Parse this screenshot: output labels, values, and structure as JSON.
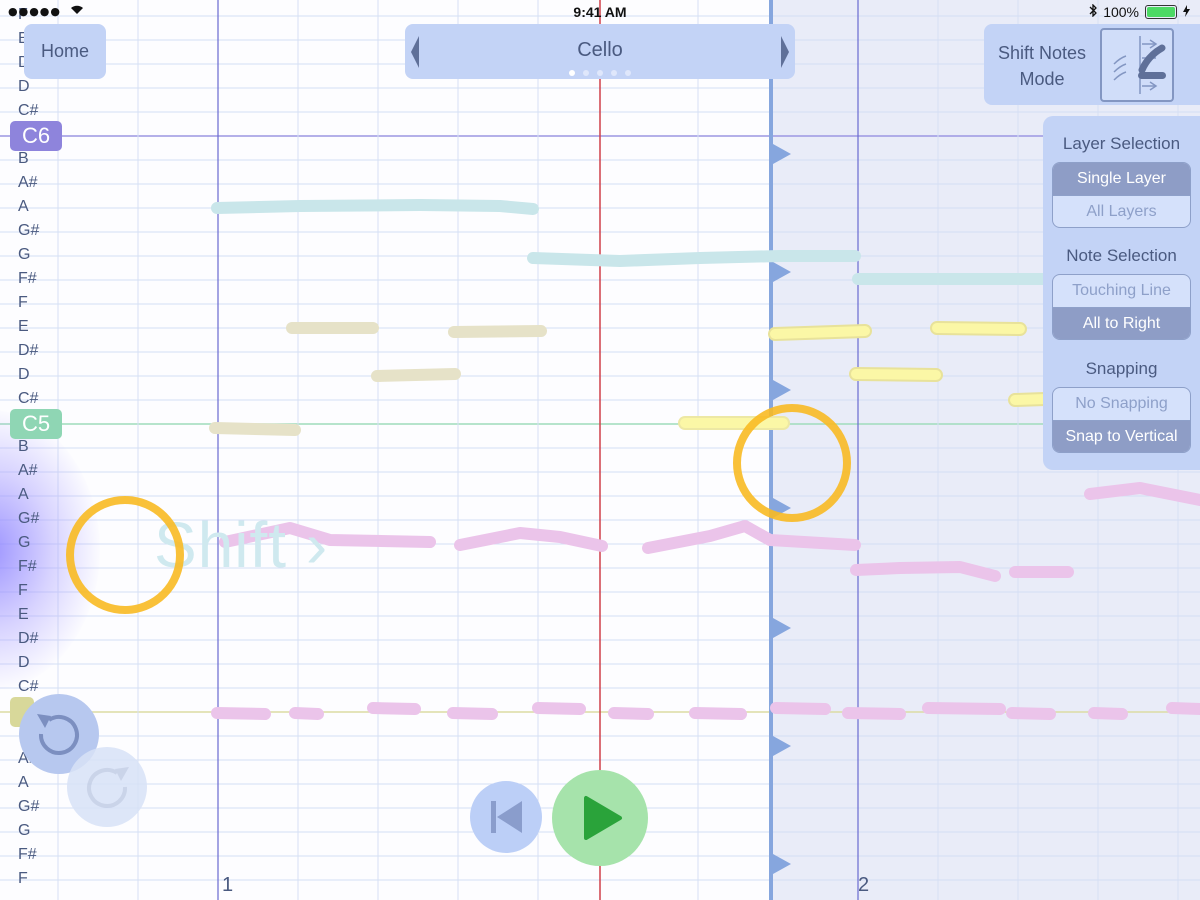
{
  "status_bar": {
    "signal": "●●●●●",
    "time": "9:41 AM",
    "battery": "100%",
    "battery_level": 1.0
  },
  "toolbar": {
    "home_label": "Home",
    "instrument_label": "Cello",
    "page_count": 5,
    "active_page": 1,
    "mode_line1": "Shift Notes",
    "mode_line2": "Mode"
  },
  "panel": {
    "layer_title": "Layer Selection",
    "layer_options": [
      "Single Layer",
      "All Layers"
    ],
    "layer_selected": 0,
    "note_title": "Note Selection",
    "note_options": [
      "Touching Line",
      "All to Right"
    ],
    "note_selected": 1,
    "snap_title": "Snapping",
    "snap_options": [
      "No Snapping",
      "Snap to Vertical"
    ],
    "snap_selected": 1
  },
  "staff": {
    "note_names_top": [
      "F",
      "E",
      "D#",
      "D",
      "C#"
    ],
    "octave_labels": [
      "C6",
      "C5"
    ],
    "note_names_c6": [
      "B",
      "A#",
      "A",
      "G#",
      "G",
      "F#",
      "F",
      "E",
      "D#",
      "D",
      "C#"
    ],
    "note_names_c5": [
      "B",
      "A#",
      "A",
      "G#",
      "G",
      "F#",
      "F",
      "E",
      "D#",
      "D",
      "C#"
    ],
    "note_names_bottom": [
      "A#",
      "A",
      "G#",
      "G",
      "F#",
      "F"
    ],
    "measure_numbers": [
      "1",
      "2"
    ]
  },
  "overlay": {
    "shift_hint": "Shift ›"
  },
  "colors": {
    "button_bg": "#c3d3f6",
    "button_text": "#4a5a80",
    "playhead": "#d0404a",
    "shift_line": "#86a6de",
    "c6_tag": "#8e84dc",
    "c5_tag": "#8fd6b4",
    "teal_stroke": "#c9e6ea",
    "tan_stroke": "#e6e2c8",
    "yellow_stroke": "#fbf7a6",
    "pink_stroke": "#ebc4ea",
    "touch_ring": "#f8ba24",
    "play_bg": "#a6e3ab",
    "play_icon": "#2aa33a"
  }
}
